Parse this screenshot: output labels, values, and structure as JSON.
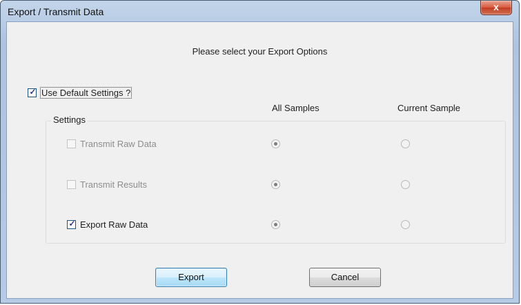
{
  "window": {
    "title": "Export / Transmit Data",
    "close_glyph": "x"
  },
  "header": "Please select your Export Options",
  "use_default": {
    "label": "Use Default Settings ?",
    "checked": true
  },
  "columns": {
    "all": "All Samples",
    "current": "Current Sample"
  },
  "group_label": "Settings",
  "options": [
    {
      "label": "Transmit Raw Data",
      "checked": false,
      "enabled": false,
      "scope": "All Samples"
    },
    {
      "label": "Transmit Results",
      "checked": false,
      "enabled": false,
      "scope": "All Samples"
    },
    {
      "label": "Export Raw Data",
      "checked": true,
      "enabled": true,
      "scope": "All Samples"
    }
  ],
  "buttons": {
    "export": "Export",
    "cancel": "Cancel"
  }
}
